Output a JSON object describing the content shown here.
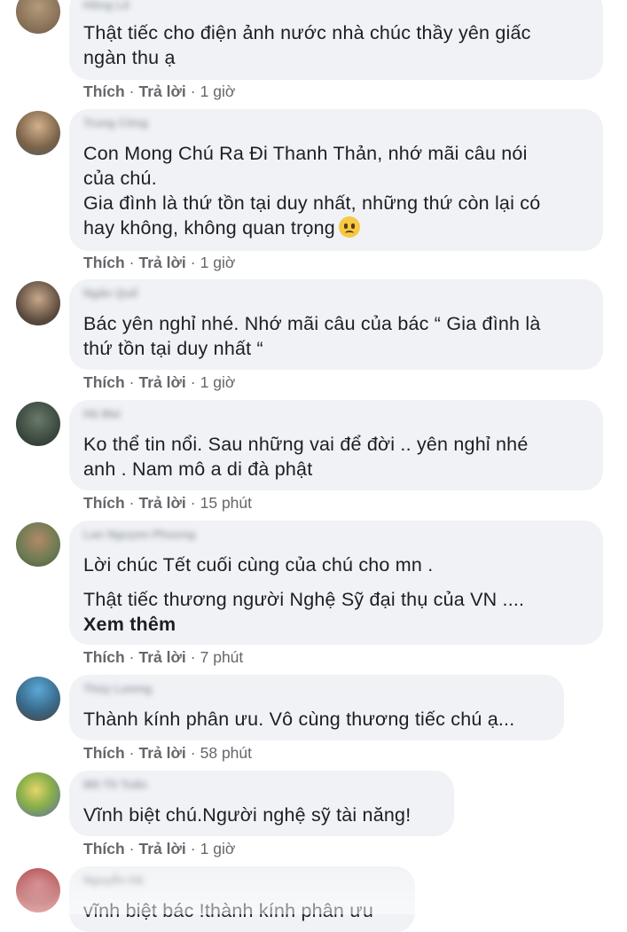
{
  "colors": {
    "bubble": "#f0f2f5",
    "action_text": "#65676b",
    "body_text": "#1c1e21"
  },
  "labels": {
    "like": "Thích",
    "reply": "Trả lời",
    "separator": "·",
    "see_more": "Xem thêm"
  },
  "comments": [
    {
      "author": "Hồng Lê",
      "lines": [
        "Thật tiếc cho điện ảnh nước nhà chúc thầy yên giấc",
        "ngàn thu ạ"
      ],
      "time": "1 giờ"
    },
    {
      "author": "Trung Công",
      "lines": [
        "Con Mong Chú Ra Đi Thanh Thản, nhớ mãi câu nói",
        "của chú.",
        "Gia đình là thứ tồn tại duy nhất, những thứ còn lại có",
        "hay không, không quan trọng"
      ],
      "emoji": "crying-face-icon",
      "time": "1 giờ"
    },
    {
      "author": "Ngân Quế",
      "lines": [
        "Bác yên nghỉ nhé. Nhớ mãi câu của bác “ Gia đình là",
        "thứ tồn tại duy nhất “"
      ],
      "time": "1 giờ"
    },
    {
      "author": "Hà Mai",
      "lines": [
        "Ko thể tin nổi. Sau những vai để đời .. yên nghỉ nhé",
        "anh . Nam mô a di đà phật"
      ],
      "time": "15 phút"
    },
    {
      "author": "Lan Nguyen Phuong",
      "lines": [
        "Lời chúc Tết cuối cùng của chú cho mn .",
        "Thật tiếc thương người Nghệ Sỹ đại thụ của VN ...."
      ],
      "see_more": "Xem thêm",
      "time": "7 phút"
    },
    {
      "author": "Thủy Lương",
      "lines": [
        "Thành kính phân ưu. Vô cùng thương tiếc chú ạ..."
      ],
      "time": "58 phút"
    },
    {
      "author": "Mít Tít Tuấn",
      "lines": [
        "Vĩnh biệt chú.Người nghệ sỹ tài năng!"
      ],
      "time": "1 giờ"
    },
    {
      "author": "Nguyễn Hà",
      "lines": [
        "vĩnh biệt bác !thành kính phân ưu"
      ]
    }
  ]
}
